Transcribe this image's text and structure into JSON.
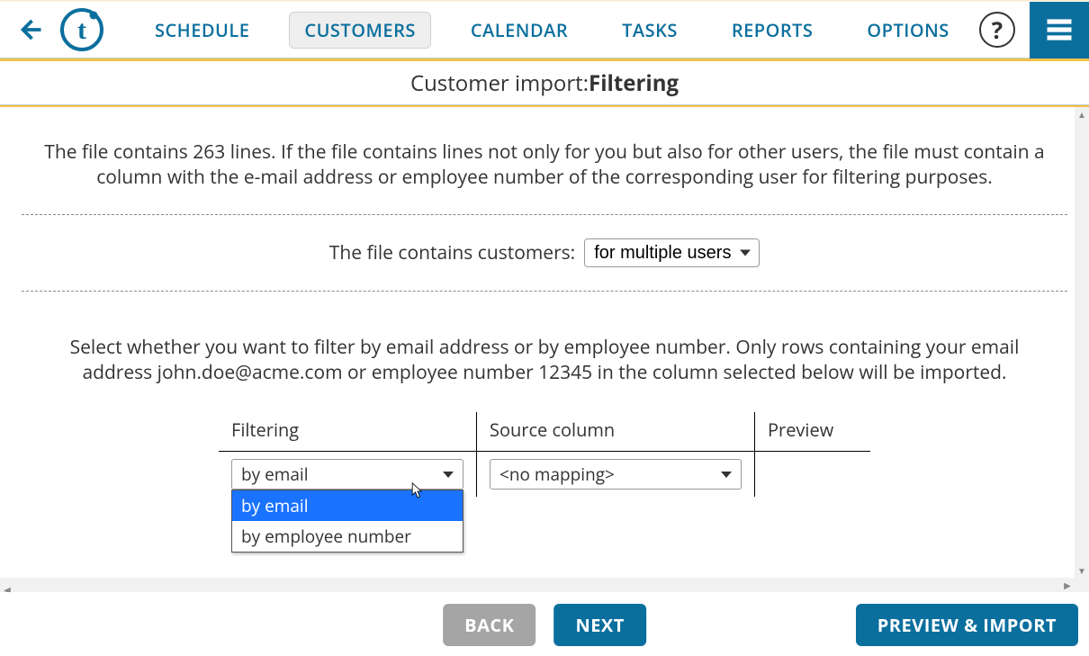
{
  "nav": {
    "items": [
      "SCHEDULE",
      "CUSTOMERS",
      "CALENDAR",
      "TASKS",
      "REPORTS",
      "OPTIONS"
    ],
    "active_index": 1
  },
  "help_label": "?",
  "page_title": {
    "prefix": "Customer import: ",
    "bold": "Filtering"
  },
  "intro_text": "The file contains 263 lines. If the file contains lines not only for you but also for other users, the file must contain a column with the e-mail address or employee number of the corresponding user for filtering purposes.",
  "scope": {
    "label": "The file contains customers: ",
    "selected": "for multiple users"
  },
  "instruction_text": "Select whether you want to filter by email address or by employee number. Only rows containing your email address john.doe@acme.com or employee number 12345 in the column selected below will be imported.",
  "table": {
    "headers": {
      "filtering": "Filtering",
      "source": "Source column",
      "preview": "Preview"
    },
    "filtering_selected": "by email",
    "filtering_options": [
      "by email",
      "by employee number"
    ],
    "filtering_highlight_index": 0,
    "source_selected": "<no mapping>",
    "preview_value": ""
  },
  "footer": {
    "back": "BACK",
    "next": "NEXT",
    "preview_import": "PREVIEW & IMPORT"
  },
  "colors": {
    "brand": "#0b6f9e",
    "accent": "#f0c24a",
    "highlight": "#1a73ff"
  }
}
